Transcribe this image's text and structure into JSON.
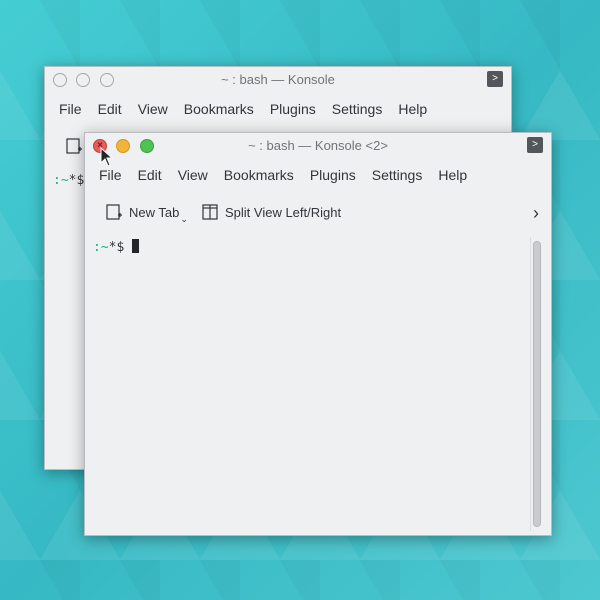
{
  "back_window": {
    "title": "~ : bash — Konsole",
    "menu": [
      "File",
      "Edit",
      "View",
      "Bookmarks",
      "Plugins",
      "Settings",
      "Help"
    ],
    "prompt_tilde": ":~",
    "prompt_tail": "*$"
  },
  "front_window": {
    "title": "~ : bash — Konsole <2>",
    "menu": [
      "File",
      "Edit",
      "View",
      "Bookmarks",
      "Plugins",
      "Settings",
      "Help"
    ],
    "toolbar": {
      "new_tab": "New Tab",
      "split_view": "Split View Left/Right"
    },
    "prompt_tilde": ":~",
    "prompt_tail": "*$ "
  },
  "colors": {
    "close": "#e85c5c",
    "minimize": "#f0b43c",
    "maximize": "#4fc254",
    "prompt_green": "#1cb27a"
  },
  "icons": {
    "new_tab": "new-tab-icon",
    "split_view": "split-view-icon",
    "overflow": "chevron-right-icon",
    "window_menu": "window-menu-icon"
  }
}
